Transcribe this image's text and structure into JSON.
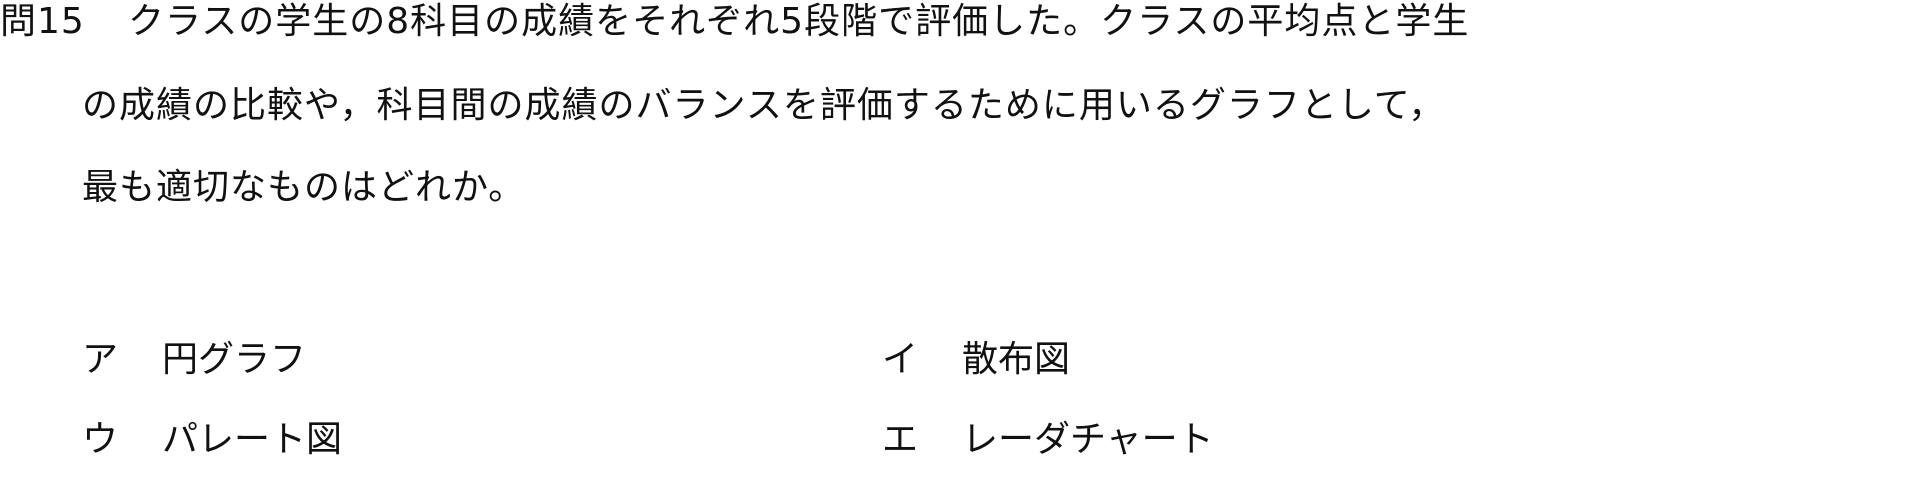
{
  "question": {
    "number": "問15",
    "line1": "クラスの学生の8科目の成績をそれぞれ5段階で評価した。クラスの平均点と学生",
    "line2": "の成績の比較や，科目間の成績のバランスを評価するために用いるグラフとして，",
    "line3": "最も適切なものはどれか。"
  },
  "choices": [
    {
      "mark": "ア",
      "text": "円グラフ"
    },
    {
      "mark": "イ",
      "text": "散布図"
    },
    {
      "mark": "ウ",
      "text": "パレート図"
    },
    {
      "mark": "エ",
      "text": "レーダチャート"
    }
  ]
}
